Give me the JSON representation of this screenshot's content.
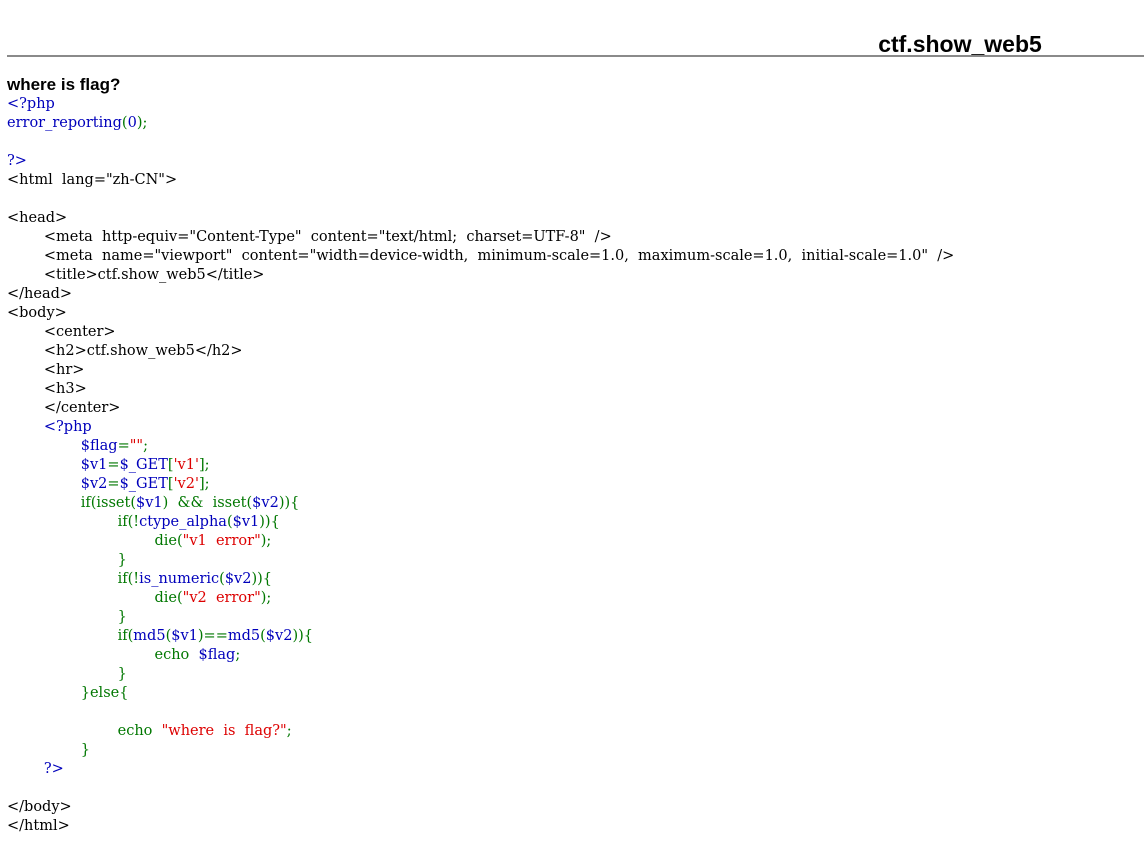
{
  "page": {
    "heading": "ctf.show_web5",
    "message": "where is flag?"
  },
  "colors": {
    "php_default": "#0000bb",
    "php_keyword": "#007700",
    "php_string": "#dd0000",
    "html_text": "#000000"
  },
  "source_code": {
    "lines": [
      [
        {
          "t": "<?php",
          "c": "default"
        }
      ],
      [
        {
          "t": "error_reporting",
          "c": "default"
        },
        {
          "t": "(",
          "c": "keyword"
        },
        {
          "t": "0",
          "c": "default"
        },
        {
          "t": ");",
          "c": "keyword"
        }
      ],
      [],
      [
        {
          "t": "?>",
          "c": "default"
        }
      ],
      [
        {
          "t": "<html  lang=\"zh-CN\">",
          "c": "html"
        }
      ],
      [],
      [
        {
          "t": "<head>",
          "c": "html"
        }
      ],
      [
        {
          "t": "        <meta  http-equiv=\"Content-Type\"  content=\"text/html;  charset=UTF-8\"  />",
          "c": "html"
        }
      ],
      [
        {
          "t": "        <meta  name=\"viewport\"  content=\"width=device-width,  minimum-scale=1.0,  maximum-scale=1.0,  initial-scale=1.0\"  />",
          "c": "html"
        }
      ],
      [
        {
          "t": "        <title>ctf.show_web5</title>",
          "c": "html"
        }
      ],
      [
        {
          "t": "</head>",
          "c": "html"
        }
      ],
      [
        {
          "t": "<body>",
          "c": "html"
        }
      ],
      [
        {
          "t": "        <center>",
          "c": "html"
        }
      ],
      [
        {
          "t": "        <h2>ctf.show_web5</h2>",
          "c": "html"
        }
      ],
      [
        {
          "t": "        <hr>",
          "c": "html"
        }
      ],
      [
        {
          "t": "        <h3>",
          "c": "html"
        }
      ],
      [
        {
          "t": "        </center>",
          "c": "html"
        }
      ],
      [
        {
          "t": "        <?php",
          "c": "default"
        }
      ],
      [
        {
          "t": "                ",
          "c": "html"
        },
        {
          "t": "$flag",
          "c": "default"
        },
        {
          "t": "=",
          "c": "keyword"
        },
        {
          "t": "\"\"",
          "c": "string"
        },
        {
          "t": ";",
          "c": "keyword"
        }
      ],
      [
        {
          "t": "                ",
          "c": "html"
        },
        {
          "t": "$v1",
          "c": "default"
        },
        {
          "t": "=",
          "c": "keyword"
        },
        {
          "t": "$_GET",
          "c": "default"
        },
        {
          "t": "[",
          "c": "keyword"
        },
        {
          "t": "'v1'",
          "c": "string"
        },
        {
          "t": "];",
          "c": "keyword"
        }
      ],
      [
        {
          "t": "                ",
          "c": "html"
        },
        {
          "t": "$v2",
          "c": "default"
        },
        {
          "t": "=",
          "c": "keyword"
        },
        {
          "t": "$_GET",
          "c": "default"
        },
        {
          "t": "[",
          "c": "keyword"
        },
        {
          "t": "'v2'",
          "c": "string"
        },
        {
          "t": "];",
          "c": "keyword"
        }
      ],
      [
        {
          "t": "                ",
          "c": "html"
        },
        {
          "t": "if(isset(",
          "c": "keyword"
        },
        {
          "t": "$v1",
          "c": "default"
        },
        {
          "t": ")  &&  isset(",
          "c": "keyword"
        },
        {
          "t": "$v2",
          "c": "default"
        },
        {
          "t": ")){",
          "c": "keyword"
        }
      ],
      [
        {
          "t": "                        ",
          "c": "html"
        },
        {
          "t": "if(!",
          "c": "keyword"
        },
        {
          "t": "ctype_alpha",
          "c": "default"
        },
        {
          "t": "(",
          "c": "keyword"
        },
        {
          "t": "$v1",
          "c": "default"
        },
        {
          "t": ")){",
          "c": "keyword"
        }
      ],
      [
        {
          "t": "                                ",
          "c": "html"
        },
        {
          "t": "die(",
          "c": "keyword"
        },
        {
          "t": "\"v1  error\"",
          "c": "string"
        },
        {
          "t": ");",
          "c": "keyword"
        }
      ],
      [
        {
          "t": "                        ",
          "c": "html"
        },
        {
          "t": "}",
          "c": "keyword"
        }
      ],
      [
        {
          "t": "                        ",
          "c": "html"
        },
        {
          "t": "if(!",
          "c": "keyword"
        },
        {
          "t": "is_numeric",
          "c": "default"
        },
        {
          "t": "(",
          "c": "keyword"
        },
        {
          "t": "$v2",
          "c": "default"
        },
        {
          "t": ")){",
          "c": "keyword"
        }
      ],
      [
        {
          "t": "                                ",
          "c": "html"
        },
        {
          "t": "die(",
          "c": "keyword"
        },
        {
          "t": "\"v2  error\"",
          "c": "string"
        },
        {
          "t": ");",
          "c": "keyword"
        }
      ],
      [
        {
          "t": "                        ",
          "c": "html"
        },
        {
          "t": "}",
          "c": "keyword"
        }
      ],
      [
        {
          "t": "                        ",
          "c": "html"
        },
        {
          "t": "if(",
          "c": "keyword"
        },
        {
          "t": "md5",
          "c": "default"
        },
        {
          "t": "(",
          "c": "keyword"
        },
        {
          "t": "$v1",
          "c": "default"
        },
        {
          "t": ")==",
          "c": "keyword"
        },
        {
          "t": "md5",
          "c": "default"
        },
        {
          "t": "(",
          "c": "keyword"
        },
        {
          "t": "$v2",
          "c": "default"
        },
        {
          "t": ")){",
          "c": "keyword"
        }
      ],
      [
        {
          "t": "                                ",
          "c": "html"
        },
        {
          "t": "echo  ",
          "c": "keyword"
        },
        {
          "t": "$flag",
          "c": "default"
        },
        {
          "t": ";",
          "c": "keyword"
        }
      ],
      [
        {
          "t": "                        ",
          "c": "html"
        },
        {
          "t": "}",
          "c": "keyword"
        }
      ],
      [
        {
          "t": "                ",
          "c": "html"
        },
        {
          "t": "}else{",
          "c": "keyword"
        }
      ],
      [],
      [
        {
          "t": "                        ",
          "c": "html"
        },
        {
          "t": "echo  ",
          "c": "keyword"
        },
        {
          "t": "\"where  is  flag?\"",
          "c": "string"
        },
        {
          "t": ";",
          "c": "keyword"
        }
      ],
      [
        {
          "t": "                ",
          "c": "html"
        },
        {
          "t": "}",
          "c": "keyword"
        }
      ],
      [
        {
          "t": "        ?>",
          "c": "default"
        }
      ],
      [],
      [
        {
          "t": "</body>",
          "c": "html"
        }
      ],
      [
        {
          "t": "</html>",
          "c": "html"
        }
      ]
    ]
  }
}
